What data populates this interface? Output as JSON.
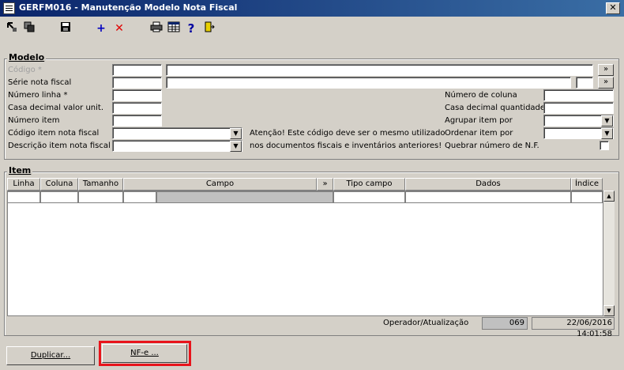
{
  "window": {
    "title": "GERFM016 - Manutenção Modelo Nota Fiscal",
    "close_glyph": "✕"
  },
  "toolbar": {
    "icons": [
      "back-icon",
      "copy-icon",
      "save-icon",
      "add-icon",
      "delete-icon",
      "print-icon",
      "table-icon",
      "help-icon",
      "exit-icon"
    ]
  },
  "modelo": {
    "legend": "Modelo",
    "codigo_label": "Código *",
    "serie_label": "Série nota fiscal",
    "numero_linha_label": "Número linha *",
    "casa_decimal_valor_label": "Casa decimal valor unit.",
    "numero_item_label": "Número item",
    "codigo_item_label": "Código item nota fiscal",
    "descricao_item_label": "Descrição item nota fiscal",
    "numero_coluna_label": "Número de coluna",
    "casa_decimal_qtd_label": "Casa decimal quantidade",
    "agrupar_label": "Agrupar item por",
    "ordenar_label": "Ordenar item por",
    "quebrar_label": "Quebrar número de N.F.",
    "atencao_line1": "Atenção! Este código deve ser o mesmo utilizado",
    "atencao_line2": "nos documentos fiscais e inventários anteriores!",
    "more_glyph": "»"
  },
  "item": {
    "legend": "Item",
    "columns": [
      "Linha",
      "Coluna",
      "Tamanho",
      "Campo",
      "»",
      "Tipo campo",
      "Dados",
      "Índice"
    ]
  },
  "status": {
    "operador_label": "Operador/Atualização",
    "operador_code": "069",
    "timestamp": "22/06/2016 14:01:58"
  },
  "buttons": {
    "duplicar": "Duplicar...",
    "nfe": "NF-e ..."
  },
  "colors": {
    "highlight": "#e8141b",
    "title_bg": "#0a246a"
  }
}
